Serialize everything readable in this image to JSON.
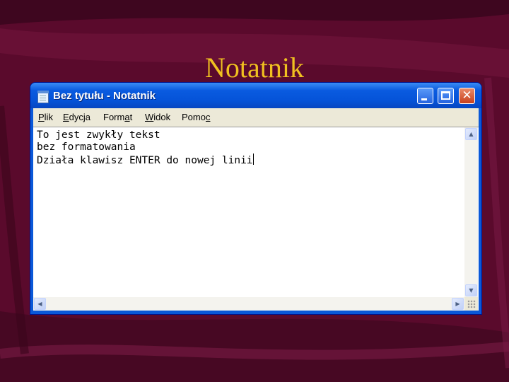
{
  "slide": {
    "title": "Notatnik"
  },
  "window": {
    "title": "Bez tytułu - Notatnik",
    "buttons": {
      "minimize_icon": "minimize-icon",
      "maximize_icon": "maximize-icon",
      "close_icon": "close-icon"
    }
  },
  "menu": {
    "items": [
      {
        "label": "Plik",
        "mnemonic": "P",
        "rest": "lik",
        "before": ""
      },
      {
        "label": "Edycja",
        "mnemonic": "E",
        "rest": "dycja",
        "before": ""
      },
      {
        "label": "Format",
        "before": "Form",
        "mnemonic": "a",
        "rest": "t"
      },
      {
        "label": "Widok",
        "mnemonic": "W",
        "rest": "idok",
        "before": ""
      },
      {
        "label": "Pomoc",
        "before": "Pomo",
        "mnemonic": "c",
        "rest": ""
      }
    ]
  },
  "editor": {
    "lines": [
      "To jest zwykły tekst",
      "bez formatowania",
      "Działa klawisz ENTER do nowej linii"
    ]
  },
  "colors": {
    "background": "#5a0a2c",
    "title": "#f0c020",
    "titlebar": "#0553d8",
    "menubar": "#ece9d8"
  }
}
